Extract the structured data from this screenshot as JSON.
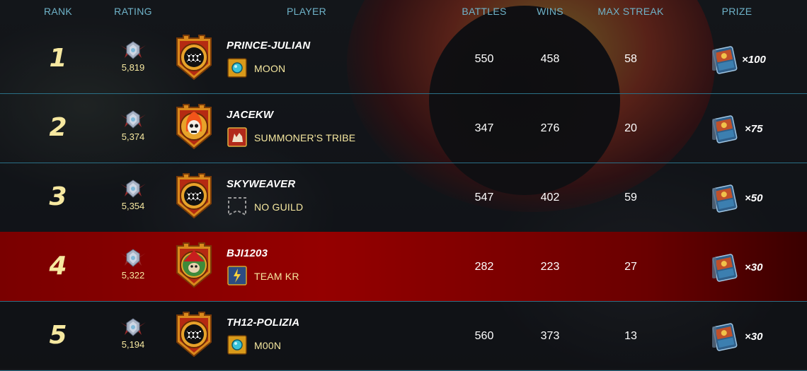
{
  "headers": {
    "rank": "RANK",
    "rating": "RATING",
    "player": "PLAYER",
    "battles": "BATTLES",
    "wins": "WINS",
    "max_streak": "MAX STREAK",
    "prize": "PRIZE"
  },
  "rows": [
    {
      "rank": "1",
      "rating": "5,819",
      "player": "PRINCE-JULIAN",
      "guild": "MOON",
      "guild_icon": "moon-guild-icon",
      "avatar": "monster-mouth-avatar",
      "battles": "550",
      "wins": "458",
      "max_streak": "58",
      "prize": "×100"
    },
    {
      "rank": "2",
      "rating": "5,374",
      "player": "JACEKW",
      "guild": "SUMMONER'S TRIBE",
      "guild_icon": "wolf-guild-icon",
      "avatar": "flame-skull-avatar",
      "battles": "347",
      "wins": "276",
      "max_streak": "20",
      "prize": "×75"
    },
    {
      "rank": "3",
      "rating": "5,354",
      "player": "SKYWEAVER",
      "guild": "NO GUILD",
      "guild_icon": "empty-guild-icon",
      "avatar": "monster-mouth-avatar",
      "battles": "547",
      "wins": "402",
      "max_streak": "59",
      "prize": "×50"
    },
    {
      "rank": "4",
      "rating": "5,322",
      "player": "BJI1203",
      "guild": "TEAM KR",
      "guild_icon": "lightning-guild-icon",
      "avatar": "red-hat-goblin-avatar",
      "battles": "282",
      "wins": "223",
      "max_streak": "27",
      "prize": "×30"
    },
    {
      "rank": "5",
      "rating": "5,194",
      "player": "TH12-POLIZIA",
      "guild": "M00N",
      "guild_icon": "moon-guild-icon",
      "avatar": "monster-mouth-avatar",
      "battles": "560",
      "wins": "373",
      "max_streak": "13",
      "prize": "×30"
    }
  ],
  "colors": {
    "header_text": "#6fb3c9",
    "rank_text": "#f6e8a0",
    "guild_text": "#f6e8a0",
    "divider": "#2a6f86",
    "highlight_row": "#950000"
  },
  "icons": {
    "rating": "rating-crest-icon",
    "prize": "card-pack-icon"
  }
}
